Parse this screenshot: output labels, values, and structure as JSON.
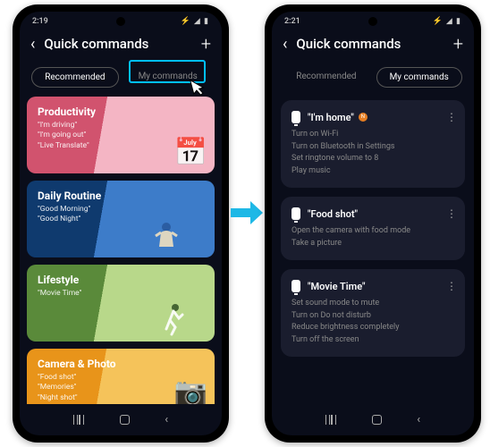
{
  "leftPhone": {
    "statusTime": "2:19",
    "statusIndicators": "✦ ⏸ •",
    "statusRight": "⚡ ◢ ▮",
    "title": "Quick commands",
    "tabs": {
      "recommended": "Recommended",
      "my": "My commands"
    },
    "cards": {
      "productivity": {
        "title": "Productivity",
        "lines": "\"I'm driving\"\n\"I'm going out\"\n\"Live Translate\""
      },
      "routine": {
        "title": "Daily Routine",
        "lines": "\"Good Morning\"\n\"Good Night\""
      },
      "lifestyle": {
        "title": "Lifestyle",
        "lines": "\"Movie Time\""
      },
      "camera": {
        "title": "Camera & Photo",
        "lines": "\"Food shot\"\n\"Memories\"\n\"Night shot\""
      }
    }
  },
  "rightPhone": {
    "statusTime": "2:21",
    "statusIndicators": "✦ ⏸ ◐",
    "statusRight": "⚡ ◢ ▮",
    "title": "Quick commands",
    "tabs": {
      "recommended": "Recommended",
      "my": "My commands"
    },
    "cards": {
      "home": {
        "title": "\"I'm home\"",
        "badge": "N",
        "lines": "Turn on Wi-Fi\nTurn on Bluetooth in Settings\nSet ringtone volume to 8\nPlay music"
      },
      "food": {
        "title": "\"Food shot\"",
        "lines": "Open the camera with food mode\nTake a picture"
      },
      "movie": {
        "title": "\"Movie Time\"",
        "lines": "Set sound mode to mute\nTurn on Do not disturb\nReduce brightness completely\nTurn off the screen"
      }
    }
  }
}
